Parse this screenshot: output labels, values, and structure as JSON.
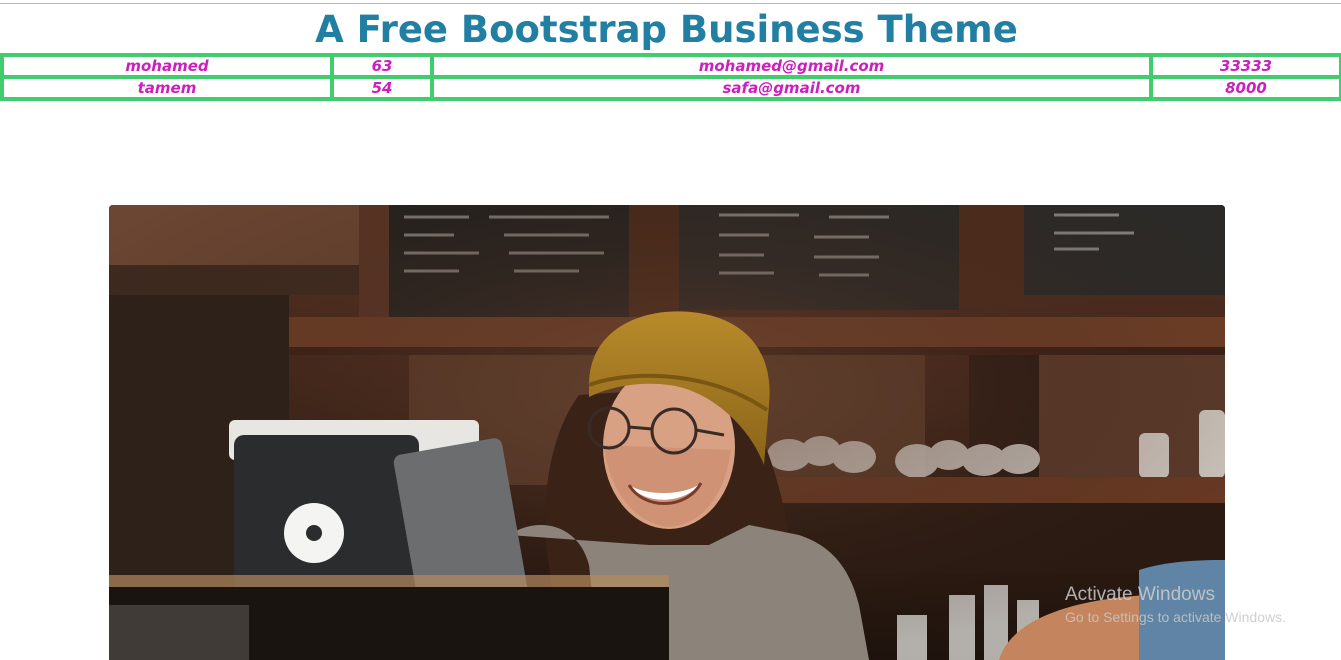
{
  "header": {
    "title": "A Free Bootstrap Business Theme"
  },
  "table": {
    "rows": [
      {
        "name": "mohamed",
        "age": "63",
        "email": "mohamed@gmail.com",
        "value": "33333"
      },
      {
        "name": "tamem",
        "age": "54",
        "email": "safa@gmail.com",
        "value": "8000"
      }
    ]
  },
  "hero": {
    "icon": "photo-cafe-barista"
  },
  "watermark": {
    "title": "Activate Windows",
    "subtitle": "Go to Settings to activate Windows."
  },
  "colors": {
    "title": "#217fa3",
    "table_border": "#41cc6e",
    "table_text": "#cc1fbd"
  }
}
